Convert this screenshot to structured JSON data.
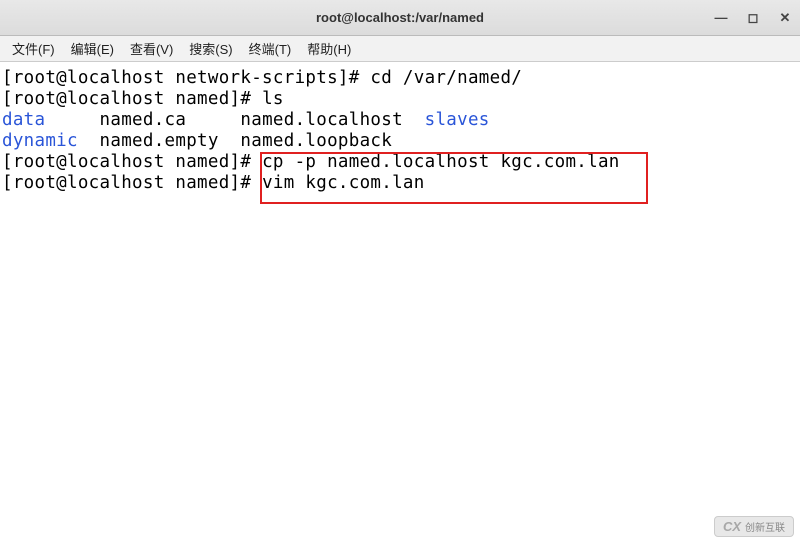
{
  "titlebar": {
    "title": "root@localhost:/var/named"
  },
  "menubar": {
    "file": "文件(F)",
    "edit": "编辑(E)",
    "view": "查看(V)",
    "search": "搜索(S)",
    "terminal": "终端(T)",
    "help": "帮助(H)"
  },
  "terminal": {
    "line1_prompt": "[root@localhost network-scripts]# ",
    "line1_cmd": "cd /var/named/",
    "line2_prompt": "[root@localhost named]# ",
    "line2_cmd": "ls",
    "ls": {
      "data": "data",
      "named_ca": "named.ca",
      "named_localhost": "named.localhost",
      "slaves": "slaves",
      "dynamic": "dynamic",
      "named_empty": "named.empty",
      "named_loopback": "named.loopback"
    },
    "line5_prompt": "[root@localhost named]# ",
    "line5_cmd": "cp -p named.localhost kgc.com.lan",
    "line6_prompt": "[root@localhost named]# ",
    "line6_cmd": "vim kgc.com.lan"
  },
  "watermark": {
    "icon": "CX",
    "text": "创新互联"
  }
}
